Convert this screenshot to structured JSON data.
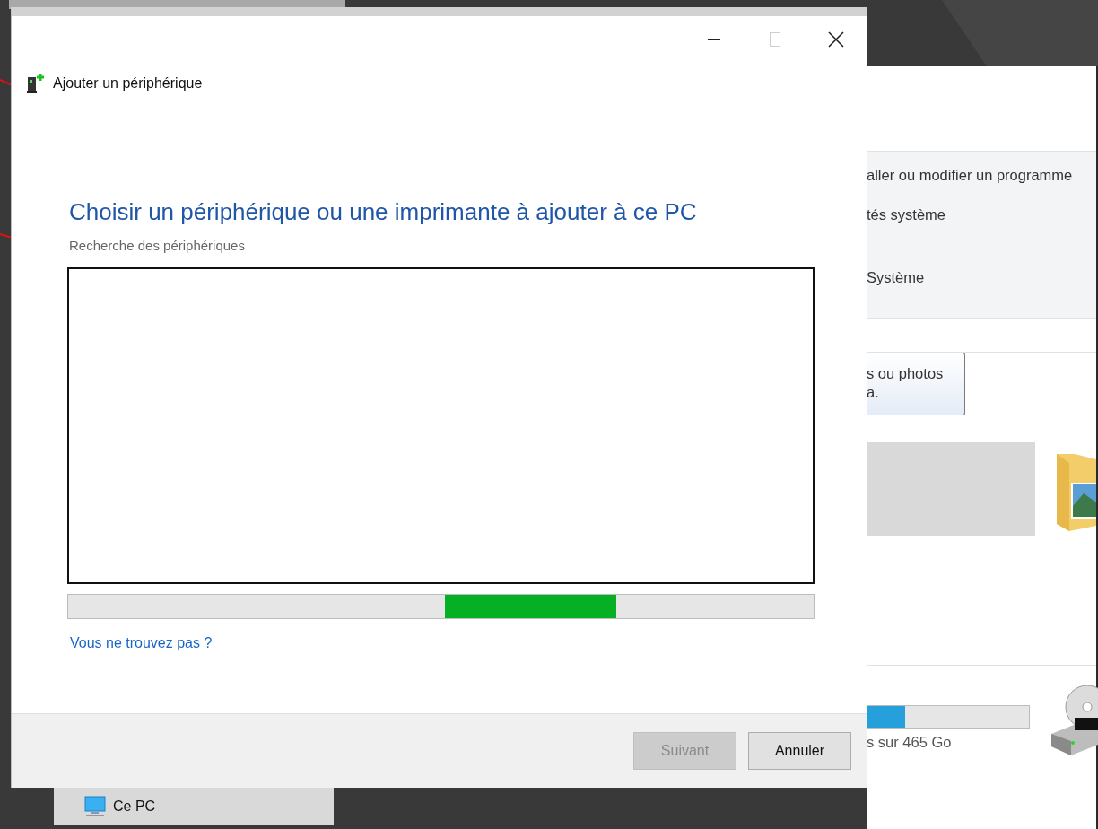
{
  "dialog": {
    "title": "Ajouter un périphérique",
    "window_buttons": [
      {
        "kind": "minimize",
        "disabled": false
      },
      {
        "kind": "maximize",
        "disabled": true
      },
      {
        "kind": "close",
        "disabled": false
      }
    ],
    "heading": "Choisir un périphérique ou une imprimante à ajouter à ce PC",
    "status": "Recherche des périphériques",
    "link": "Vous ne trouvez pas ?",
    "buttons": [
      {
        "label": "Suivant",
        "disabled": true
      },
      {
        "label": "Annuler",
        "disabled": false
      }
    ]
  },
  "background_window": {
    "ribbon_items": [
      "aller ou modifier un programme",
      "tés système"
    ],
    "group_label": "Système",
    "tooltip": [
      "s ou photos",
      "a."
    ],
    "drive": {
      "level": 0.24,
      "caption": "s sur 465 Go"
    }
  },
  "nav_item": {
    "label": "Ce PC",
    "selected": true
  }
}
